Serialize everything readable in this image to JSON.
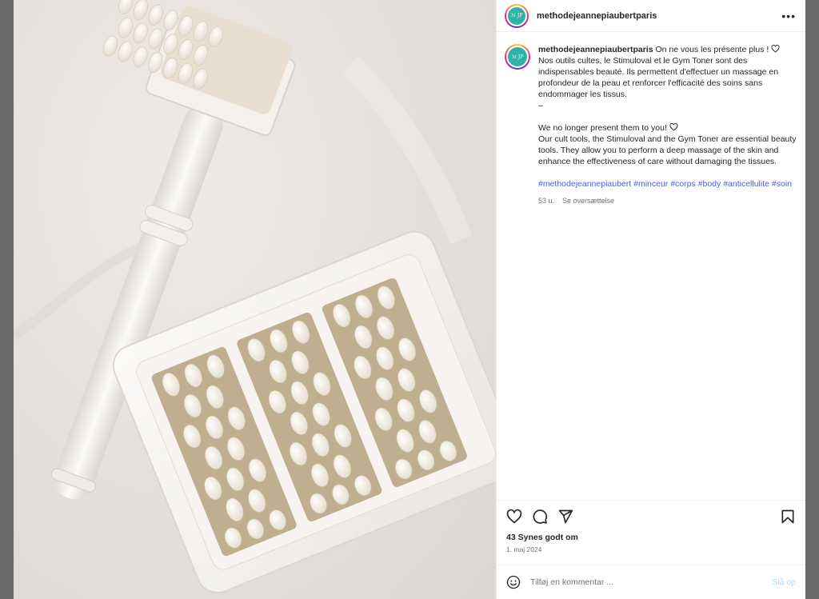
{
  "header": {
    "username": "methodejeannepiaubertparis",
    "avatar_label": "ℳ JP",
    "more_icon": "more-horizontal-icon"
  },
  "caption": {
    "username": "methodejeannepiaubertparis",
    "fr_first_line": "On ne vous les présente plus !",
    "fr_body": "Nos outils cultes, le Stimuloval et le Gym Toner sont des indispensables beauté. Ils permettent d'effectuer un massage en profondeur de la peau et renforcer l'efficacité des soins sans endommager les tissus.",
    "separator": "–",
    "en_first_line": "We no longer present them to you!",
    "en_body": "Our cult tools, the Stimuloval and the Gym Toner are essential beauty tools. They allow you to perform a deep massage of the skin and enhance the effectiveness of care without damaging the tissues.",
    "hashtags": [
      "#methodejeannepiaubert",
      "#minceur",
      "#corps",
      "#body",
      "#anticellulite",
      "#soin"
    ],
    "age": "53 u.",
    "translate": "Se oversættelse"
  },
  "actions": {
    "icons": [
      "heart-icon",
      "comment-icon",
      "share-icon",
      "bookmark-icon"
    ],
    "likes": "43 Synes godt om",
    "date": "1. maj 2024"
  },
  "comment": {
    "placeholder": "Tilføj en kommentar ...",
    "post_label": "Slå op",
    "post_color": "#b3dbff"
  },
  "colors": {
    "hashtag": "#4a5fd6",
    "avatar_bg": "#2fb3a6",
    "text": "#262626",
    "muted": "#737373"
  }
}
